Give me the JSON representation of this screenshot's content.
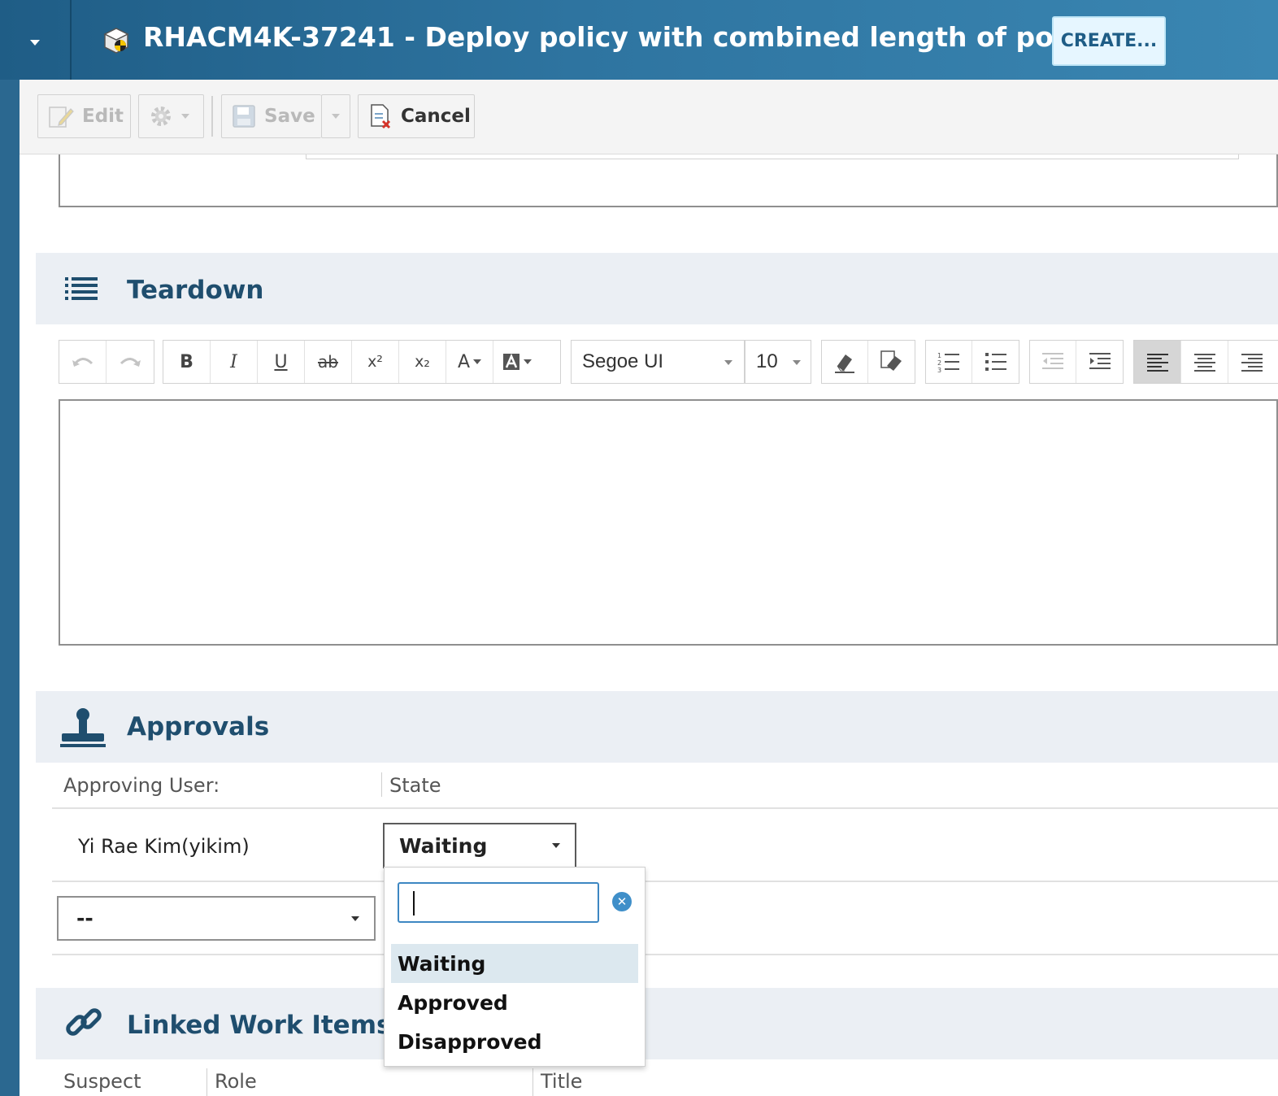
{
  "header": {
    "title": "RHACM4K-37241 - Deploy policy with combined length of po.",
    "create_label": "CREATE..."
  },
  "toolbar": {
    "edit_label": "Edit",
    "save_label": "Save",
    "cancel_label": "Cancel"
  },
  "teardown": {
    "title": "Teardown",
    "font_name": "Segoe UI",
    "font_size": "10",
    "body": ""
  },
  "approvals": {
    "title": "Approvals",
    "col_user": "Approving User:",
    "col_state": "State",
    "rows": [
      {
        "user": "Yi Rae Kim(yikim)",
        "state": "Waiting"
      }
    ],
    "new_user_value": "--",
    "state_options": [
      "Waiting",
      "Approved",
      "Disapproved"
    ],
    "state_search_value": ""
  },
  "linked": {
    "title": "Linked Work Items",
    "col_suspect": "Suspect",
    "col_role": "Role",
    "col_title": "Title"
  },
  "colors": {
    "header_bg": "#2e74a0",
    "section_bg": "#ebeff4",
    "section_title": "#1f4e6e",
    "accent": "#3d87c2"
  }
}
